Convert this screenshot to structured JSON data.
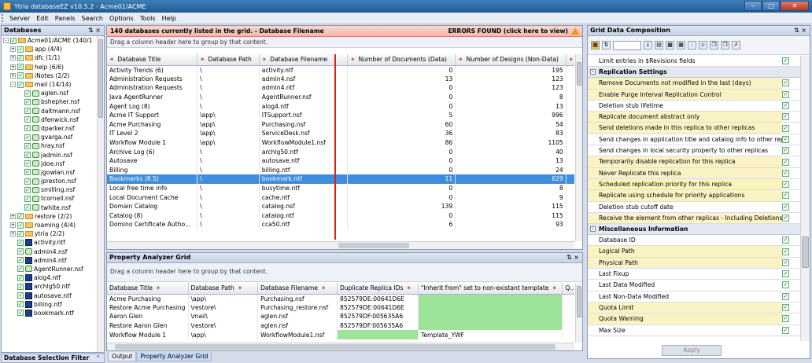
{
  "window": {
    "title": "Ytria databaseEZ v10.5.2 - Acme01/ACME"
  },
  "menu": [
    "Server",
    "Edit",
    "Panels",
    "Search",
    "Options",
    "Tools",
    "Help"
  ],
  "databases_panel": {
    "title": "Databases",
    "footer": "Database Selection Filter",
    "tree": [
      {
        "label": "Acme01/ACME (140/1",
        "level": 0,
        "kind": "folder",
        "exp": "-"
      },
      {
        "label": "app (4/4)",
        "level": 1,
        "kind": "folder",
        "exp": "+"
      },
      {
        "label": "dfc (1/1)",
        "level": 1,
        "kind": "folder",
        "exp": "+"
      },
      {
        "label": "help (6/6)",
        "level": 1,
        "kind": "folder",
        "exp": "+"
      },
      {
        "label": "iNotes (2/2)",
        "level": 1,
        "kind": "folder",
        "exp": "+"
      },
      {
        "label": "mail (14/14)",
        "level": 1,
        "kind": "folder",
        "exp": "-"
      },
      {
        "label": "aglen.nsf",
        "level": 2,
        "kind": "db"
      },
      {
        "label": "bshepher.nsf",
        "level": 2,
        "kind": "db"
      },
      {
        "label": "daltmann.nsf",
        "level": 2,
        "kind": "db"
      },
      {
        "label": "dfenwick.nsf",
        "level": 2,
        "kind": "db"
      },
      {
        "label": "dparker.nsf",
        "level": 2,
        "kind": "db"
      },
      {
        "label": "gvarga.nsf",
        "level": 2,
        "kind": "db"
      },
      {
        "label": "hray.nsf",
        "level": 2,
        "kind": "db"
      },
      {
        "label": "jadmin.nsf",
        "level": 2,
        "kind": "db"
      },
      {
        "label": "jdoe.nsf",
        "level": 2,
        "kind": "db"
      },
      {
        "label": "jgowlan.nsf",
        "level": 2,
        "kind": "db"
      },
      {
        "label": "jpreston.nsf",
        "level": 2,
        "kind": "db"
      },
      {
        "label": "smilling.nsf",
        "level": 2,
        "kind": "db"
      },
      {
        "label": "tcornell.nsf",
        "level": 2,
        "kind": "db"
      },
      {
        "label": "twhite.nsf",
        "level": 2,
        "kind": "db"
      },
      {
        "label": "restore (2/2)",
        "level": 1,
        "kind": "folder",
        "exp": "+"
      },
      {
        "label": "roaming (4/4)",
        "level": 1,
        "kind": "folder",
        "exp": "+"
      },
      {
        "label": "ytria (2/2)",
        "level": 1,
        "kind": "folder",
        "exp": "+"
      },
      {
        "label": "activity.ntf",
        "level": 1,
        "kind": "ntf"
      },
      {
        "label": "admin4.nsf",
        "level": 1,
        "kind": "db"
      },
      {
        "label": "admin4.ntf",
        "level": 1,
        "kind": "ntf"
      },
      {
        "label": "AgentRunner.nsf",
        "level": 1,
        "kind": "db"
      },
      {
        "label": "alog4.ntf",
        "level": 1,
        "kind": "ntf"
      },
      {
        "label": "archlg50.ntf",
        "level": 1,
        "kind": "ntf"
      },
      {
        "label": "autosave.ntf",
        "level": 1,
        "kind": "ntf"
      },
      {
        "label": "billing.ntf",
        "level": 1,
        "kind": "ntf"
      },
      {
        "label": "bookmark.ntf",
        "level": 1,
        "kind": "ntf"
      }
    ]
  },
  "grid": {
    "status": "140 databases currently listed in the grid. - Database Filename",
    "errors": "ERRORS FOUND (click here to view)",
    "hint": "Drag a column header here to group by that content.",
    "columns": [
      "Database Title",
      "Database Path",
      "Database Filename",
      "Number of Documents (Data)",
      "Number of Designs (Non-Data)",
      "Number of"
    ],
    "rows": [
      [
        "Activity Trends (6)",
        "\\",
        "activity.ntf",
        "0",
        "195"
      ],
      [
        "Administration Requests",
        "\\",
        "admin4.nsf",
        "13",
        "123"
      ],
      [
        "Administration Requests",
        "\\",
        "admin4.ntf",
        "0",
        "123"
      ],
      [
        "Java AgentRunner",
        "\\",
        "AgentRunner.nsf",
        "0",
        "8"
      ],
      [
        "Agent Log (8)",
        "\\",
        "alog4.ntf",
        "0",
        "13"
      ],
      [
        "Acme IT Support",
        "\\app\\",
        "ITSupport.nsf",
        "5",
        "996"
      ],
      [
        "Acme Purchasing",
        "\\app\\",
        "Purchasing.nsf",
        "60",
        "54"
      ],
      [
        "IT Level 2",
        "\\app\\",
        "ServiceDesk.nsf",
        "36",
        "83"
      ],
      [
        "Workflow Module 1",
        "\\app\\",
        "WorkflowModule1.nsf",
        "86",
        "1105"
      ],
      [
        "Archive Log (6)",
        "\\",
        "archlg50.ntf",
        "0",
        "40"
      ],
      [
        "Autosave",
        "\\",
        "autosave.ntf",
        "0",
        "13"
      ],
      [
        "Billing",
        "\\",
        "billing.ntf",
        "0",
        "24"
      ],
      [
        "Bookmarks (8.5)",
        "\\",
        "bookmark.ntf",
        "11",
        "629"
      ],
      [
        "Local free time info",
        "\\",
        "busytime.ntf",
        "0",
        "8"
      ],
      [
        "Local Document Cache",
        "\\",
        "cache.ntf",
        "0",
        "9"
      ],
      [
        "Domain Catalog",
        "\\",
        "catalog.nsf",
        "139",
        "115"
      ],
      [
        "Catalog (8)",
        "\\",
        "catalog.ntf",
        "0",
        "115"
      ],
      [
        "Domino Certificate Autho...",
        "\\",
        "cca50.ntf",
        "6",
        "93"
      ]
    ]
  },
  "property_grid": {
    "title": "Property Analyzer Grid",
    "hint": "Drag a column header here to group by that content.",
    "columns": [
      "Database Title",
      "Database Path",
      "Database Filename",
      "Duplicate Replica IDs",
      "\"Inherit from\" set to non-existant template",
      "Q..."
    ],
    "rows": [
      [
        "Acme Purchasing",
        "\\app\\",
        "Purchasing.nsf",
        "852579DE:00641D6E",
        ""
      ],
      [
        "Restore Acme Purchasing",
        "\\restore\\",
        "Purchasing_restore.nsf",
        "852579DE:00641D6E",
        ""
      ],
      [
        "Aaron Glen",
        "\\mail\\",
        "aglen.nsf",
        "852579DF:005635A6",
        ""
      ],
      [
        "Restore Aaron Glen",
        "\\restore\\",
        "aglen.nsf",
        "852579DF:005635A6",
        ""
      ],
      [
        "Workflow Module 1",
        "\\app\\",
        "WorkflowModule1.nsf",
        "",
        "Template_YWF"
      ]
    ],
    "tabs": [
      "Output",
      "Property Analyzer Grid"
    ]
  },
  "composition": {
    "title": "Grid Data Composition",
    "apply": "Apply",
    "items": [
      {
        "t": "item",
        "label": "Limit entries in $Revisions fields",
        "hl": false
      },
      {
        "t": "cat",
        "label": "Replication Settings"
      },
      {
        "t": "item",
        "label": "Remove Documents not modified in the last (days)",
        "hl": true
      },
      {
        "t": "item",
        "label": "Enable Purge Interval Replication Control",
        "hl": true
      },
      {
        "t": "item",
        "label": "Deletion stub lifetime",
        "hl": false
      },
      {
        "t": "item",
        "label": "Replicate document abstract only",
        "hl": true
      },
      {
        "t": "item",
        "label": "Send deletions made in this replica to other replicas",
        "hl": true
      },
      {
        "t": "item",
        "label": "Send changes in application title and catalog info to other replic",
        "hl": false
      },
      {
        "t": "item",
        "label": "Send changes in local security property to other replicas",
        "hl": false
      },
      {
        "t": "item",
        "label": "Temporarily disable replication for this replica",
        "hl": true
      },
      {
        "t": "item",
        "label": "Never Replicate this replica",
        "hl": true
      },
      {
        "t": "item",
        "label": "Scheduled replication priority for this replica",
        "hl": true
      },
      {
        "t": "item",
        "label": "Replicate using schedule for priority applications",
        "hl": true
      },
      {
        "t": "item",
        "label": "Deletion stub cutoff date",
        "hl": false
      },
      {
        "t": "item",
        "label": "Receive the element from other replicas - Including Deletions",
        "hl": true
      },
      {
        "t": "cat",
        "label": "Miscellaneous Information"
      },
      {
        "t": "item",
        "label": "Database ID",
        "hl": false
      },
      {
        "t": "item",
        "label": "Logical Path",
        "hl": true
      },
      {
        "t": "item",
        "label": "Physical Path",
        "hl": true
      },
      {
        "t": "item",
        "label": "Last Fixup",
        "hl": false
      },
      {
        "t": "item",
        "label": "Last Data Modified",
        "hl": false
      },
      {
        "t": "item",
        "label": "Last Non-Data Modified",
        "hl": false
      },
      {
        "t": "item",
        "label": "Quota Limit",
        "hl": true
      },
      {
        "t": "item",
        "label": "Quota Warning",
        "hl": true
      },
      {
        "t": "item",
        "label": "Max Size",
        "hl": false
      }
    ]
  }
}
